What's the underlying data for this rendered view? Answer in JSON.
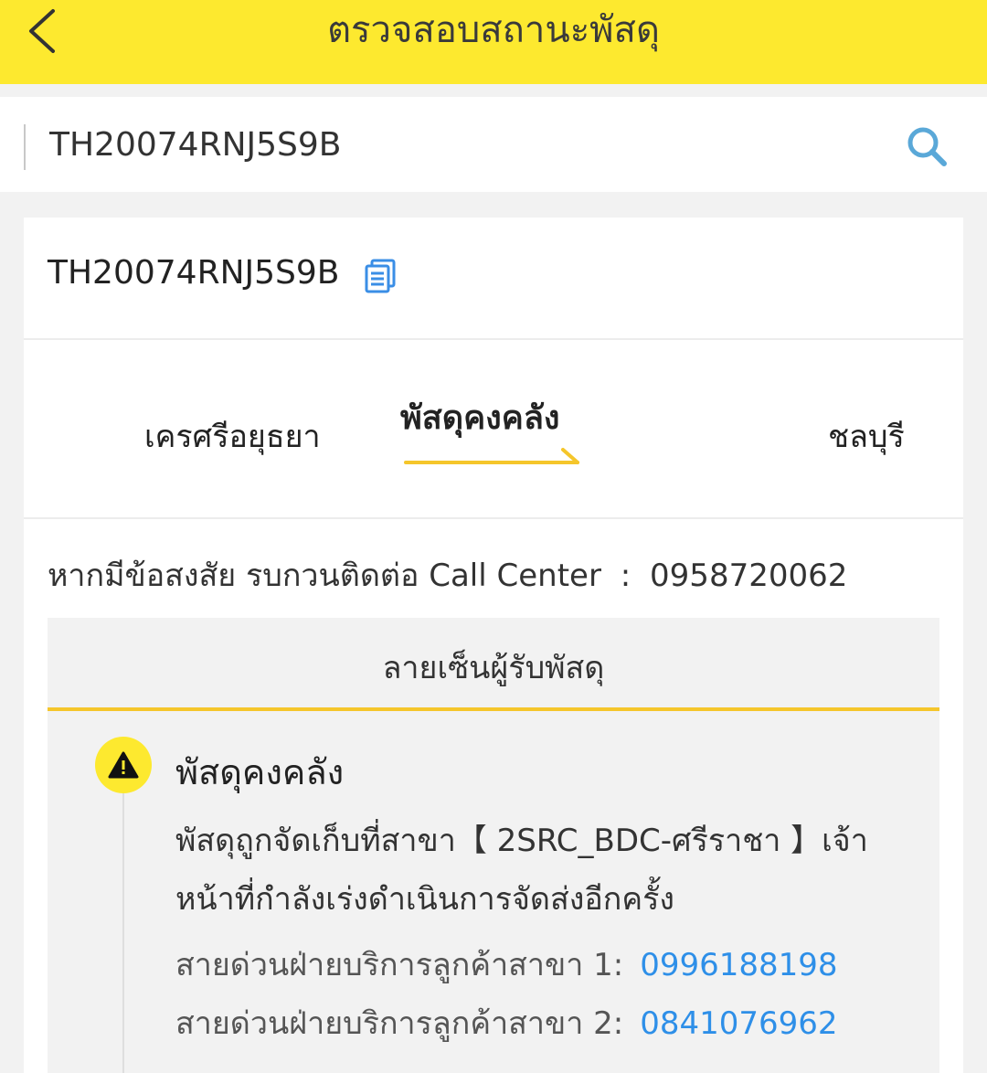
{
  "header": {
    "title": "ตรวจสอบสถานะพัสดุ"
  },
  "search": {
    "value": "TH20074RNJ5S9B",
    "placeholder": ""
  },
  "parcel": {
    "tracking_number": "TH20074RNJ5S9B"
  },
  "route": {
    "origin": "เครศรีอยุธยา",
    "status": "พัสดุคงคลัง",
    "destination": "ชลบุรี"
  },
  "contact": {
    "label": "หากมีข้อสงสัย รบกวนติดต่อ Call Center",
    "separator": ":",
    "phone": "0958720062"
  },
  "signature": {
    "header": "ลายเซ็นผู้รับพัสดุ"
  },
  "event": {
    "title": "พัสดุคงคลัง",
    "description": "พัสดุถูกจัดเก็บที่สาขา【 2SRC_BDC-ศรีราชา 】เจ้าหน้าที่กำลังเร่งดำเนินการจัดส่งอีกครั้ง",
    "hotlines": [
      {
        "label": "สายด่วนฝ่ายบริการลูกค้าสาขา 1:",
        "phone": "0996188198"
      },
      {
        "label": "สายด่วนฝ่ายบริการลูกค้าสาขา 2:",
        "phone": "0841076962"
      }
    ]
  },
  "colors": {
    "header_bg": "#fde92f",
    "accent_yellow": "#f5c62b",
    "link_blue": "#2e8fe8",
    "copy_icon_blue": "#3a8ee6",
    "search_icon_blue": "#5aa8d8"
  }
}
